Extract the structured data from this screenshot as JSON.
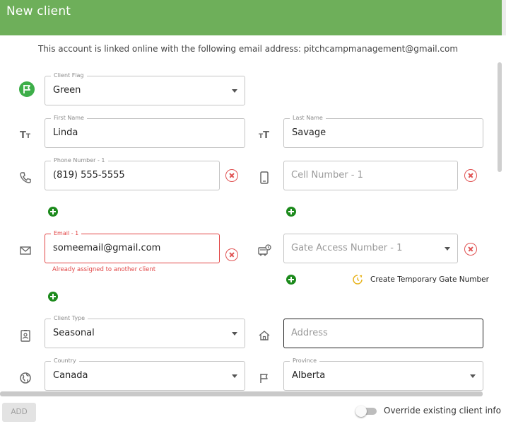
{
  "header": {
    "title": "New client"
  },
  "linked_message": "This account is linked online with the following email address:  pitchcampmanagement@gmail.com",
  "client_flag": {
    "label": "Client Flag",
    "value": "Green"
  },
  "first_name": {
    "label": "First Name",
    "value": "Linda"
  },
  "last_name": {
    "label": "Last Name",
    "value": "Savage"
  },
  "phone": {
    "label": "Phone Number - 1",
    "value": "(819) 555-5555"
  },
  "cell": {
    "placeholder": "Cell Number - 1"
  },
  "email": {
    "label": "Email - 1",
    "value": "someemail@gmail.com",
    "error": "Already assigned to another client"
  },
  "gate": {
    "placeholder": "Gate Access Number - 1"
  },
  "temp_gate_label": "Create Temporary Gate Number",
  "client_type": {
    "label": "Client Type",
    "value": "Seasonal"
  },
  "address": {
    "placeholder": "Address"
  },
  "country": {
    "label": "Country",
    "value": "Canada"
  },
  "province": {
    "label": "Province",
    "value": "Alberta"
  },
  "footer": {
    "add_label": "ADD",
    "override_label": "Override existing client info",
    "override_checked": false
  },
  "icons": {
    "flag": "flag-circle-icon",
    "first_name": "text-size-icon",
    "last_name": "text-size-icon",
    "phone": "phone-icon",
    "cell": "mobile-phone-icon",
    "email": "envelope-icon",
    "gate": "gate-access-icon",
    "client_type": "id-badge-icon",
    "address": "home-icon",
    "country": "globe-icon",
    "province": "flag-icon",
    "temp_gate": "clock-icon"
  },
  "colors": {
    "header": "#6eaf5a",
    "error": "#e14545",
    "add_circle": "#1c8a1c",
    "flag_icon": "#3dae49",
    "clock_icon": "#e8b41e"
  }
}
